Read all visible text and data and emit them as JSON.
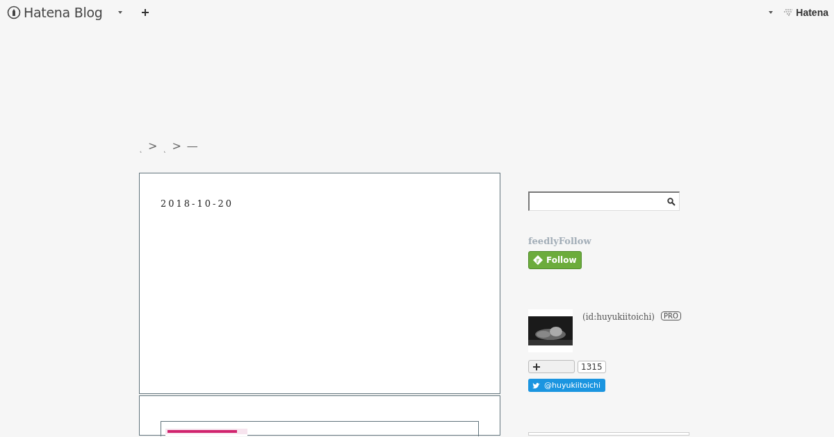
{
  "header": {
    "logo": "Hatena Blog",
    "brand": "Hatena"
  },
  "breadcrumb": [
    "˛",
    ">",
    "˛",
    ">",
    "—"
  ],
  "article": {
    "date": "2018-10-20"
  },
  "sidebar": {
    "feedly": {
      "title": "feedlyFollow",
      "button": "Follow"
    },
    "profile": {
      "id": "(id:huyukiitoichi)",
      "badge": "PRO",
      "count": "1315",
      "twitter": "@huyukiitoichi"
    }
  }
}
